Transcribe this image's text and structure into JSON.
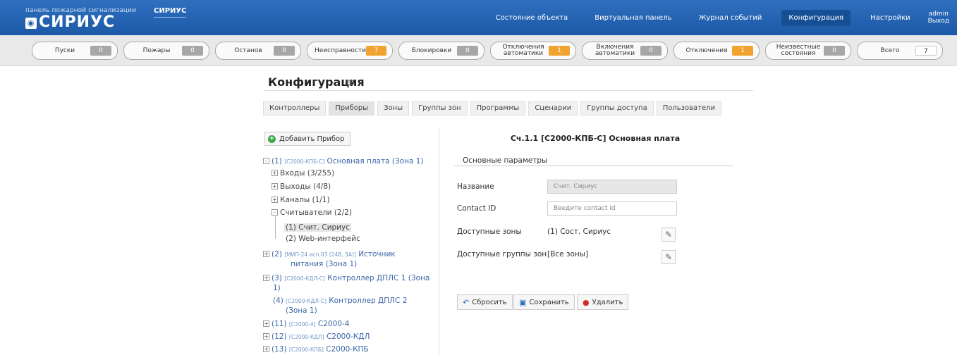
{
  "header": {
    "brand_small": "панель пожарной сигнализации",
    "brand_logo": "СИРИУС",
    "brand_tag": "СИРИУС",
    "nav": [
      "Состояние объекта",
      "Виртуальная панель",
      "Журнал событий",
      "Конфигурация",
      "Настройки"
    ],
    "active_nav": "Конфигурация",
    "user": "admin",
    "logout": "Выход"
  },
  "status_counters": [
    {
      "label": "Пуски",
      "value": "0",
      "color": "gray"
    },
    {
      "label": "Пожары",
      "value": "0",
      "color": "gray"
    },
    {
      "label": "Останов",
      "value": "0",
      "color": "gray"
    },
    {
      "label": "Неисправности",
      "value": "7",
      "color": "orange"
    },
    {
      "label": "Блокировки",
      "value": "0",
      "color": "gray"
    },
    {
      "label": "Отключения автоматики",
      "value": "1",
      "color": "orange"
    },
    {
      "label": "Включения автоматики",
      "value": "0",
      "color": "gray"
    },
    {
      "label": "Отключения",
      "value": "1",
      "color": "orange"
    },
    {
      "label": "Неизвестные состояния",
      "value": "0",
      "color": "gray"
    },
    {
      "label": "Всего",
      "value": "7",
      "color": "white"
    }
  ],
  "page": {
    "title": "Конфигурация",
    "tabs": [
      "Контроллеры",
      "Приборы",
      "Зоны",
      "Группы зон",
      "Программы",
      "Сценарии",
      "Группы доступа",
      "Пользователи"
    ],
    "active_tab": "Приборы"
  },
  "tree": {
    "add_button": "Добавить Прибор",
    "rows": [
      {
        "exp": "-",
        "num": "(1)",
        "code": "[С2000-КПБ-С]",
        "name": "Основная плата (Зона 1)"
      },
      {
        "exp": "+",
        "text": "Входы (3/255)"
      },
      {
        "exp": "+",
        "text": "Выходы (4/8)"
      },
      {
        "exp": "+",
        "text": "Каналы (1/1)"
      },
      {
        "exp": "-",
        "text": "Считыватели (2/2)"
      },
      {
        "text": "(1) Счит. Сириус"
      },
      {
        "text": "(2) Web-интерфейс"
      },
      {
        "exp": "+",
        "num": "(2)",
        "code": "[МИП-24 исп.03 (24В, 3А)]",
        "name": "Источник",
        "name2": "питания (Зона 1)"
      },
      {
        "exp": "+",
        "num": "(3)",
        "code": "[С2000-КДЛ-С]",
        "name": "Контроллер ДПЛС 1 (Зона",
        "name2": "1)"
      },
      {
        "num": "(4)",
        "code": "[С2000-КДЛ-С]",
        "name": "Контроллер ДПЛС 2",
        "name2": "(Зона 1)"
      },
      {
        "exp": "+",
        "num": "(11)",
        "code": "[С2000-4]",
        "name": "С2000-4"
      },
      {
        "exp": "+",
        "num": "(12)",
        "code": "[С2000-КДЛ]",
        "name": "С2000-КДЛ"
      },
      {
        "exp": "+",
        "num": "(13)",
        "code": "[С2000-КПБ]",
        "name": "С2000-КПБ"
      }
    ]
  },
  "detail": {
    "title": "Сч.1.1 [С2000-КПБ-С] Основная плата",
    "section": "Основные параметры",
    "name_label": "Название",
    "name_value": "Счит. Сириус",
    "contact_label": "Contact ID",
    "contact_placeholder": "Введите contact id",
    "zones_label": "Доступные зоны",
    "zones_value": "(1) Сост. Сириус",
    "groups_label": "Доступные группы зон",
    "groups_value": "[Все зоны]",
    "reset": "Сбросить",
    "save": "Сохранить",
    "delete": "Удалить"
  }
}
